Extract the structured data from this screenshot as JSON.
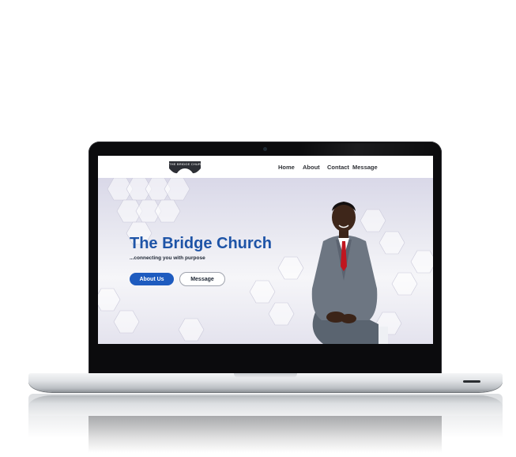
{
  "site": {
    "logo_text": "THE BRIDGE CHURCH",
    "nav": {
      "home": "Home",
      "about": "About",
      "contact": "Contact",
      "message": "Message"
    },
    "hero": {
      "title": "The Bridge Church",
      "tagline": "...connecting you with purpose",
      "primary_button": "About Us",
      "secondary_button": "Message"
    }
  },
  "colors": {
    "brand_blue": "#1e54a7",
    "button_blue": "#1e5bbf",
    "laptop_bezel": "#0b0b0d"
  }
}
